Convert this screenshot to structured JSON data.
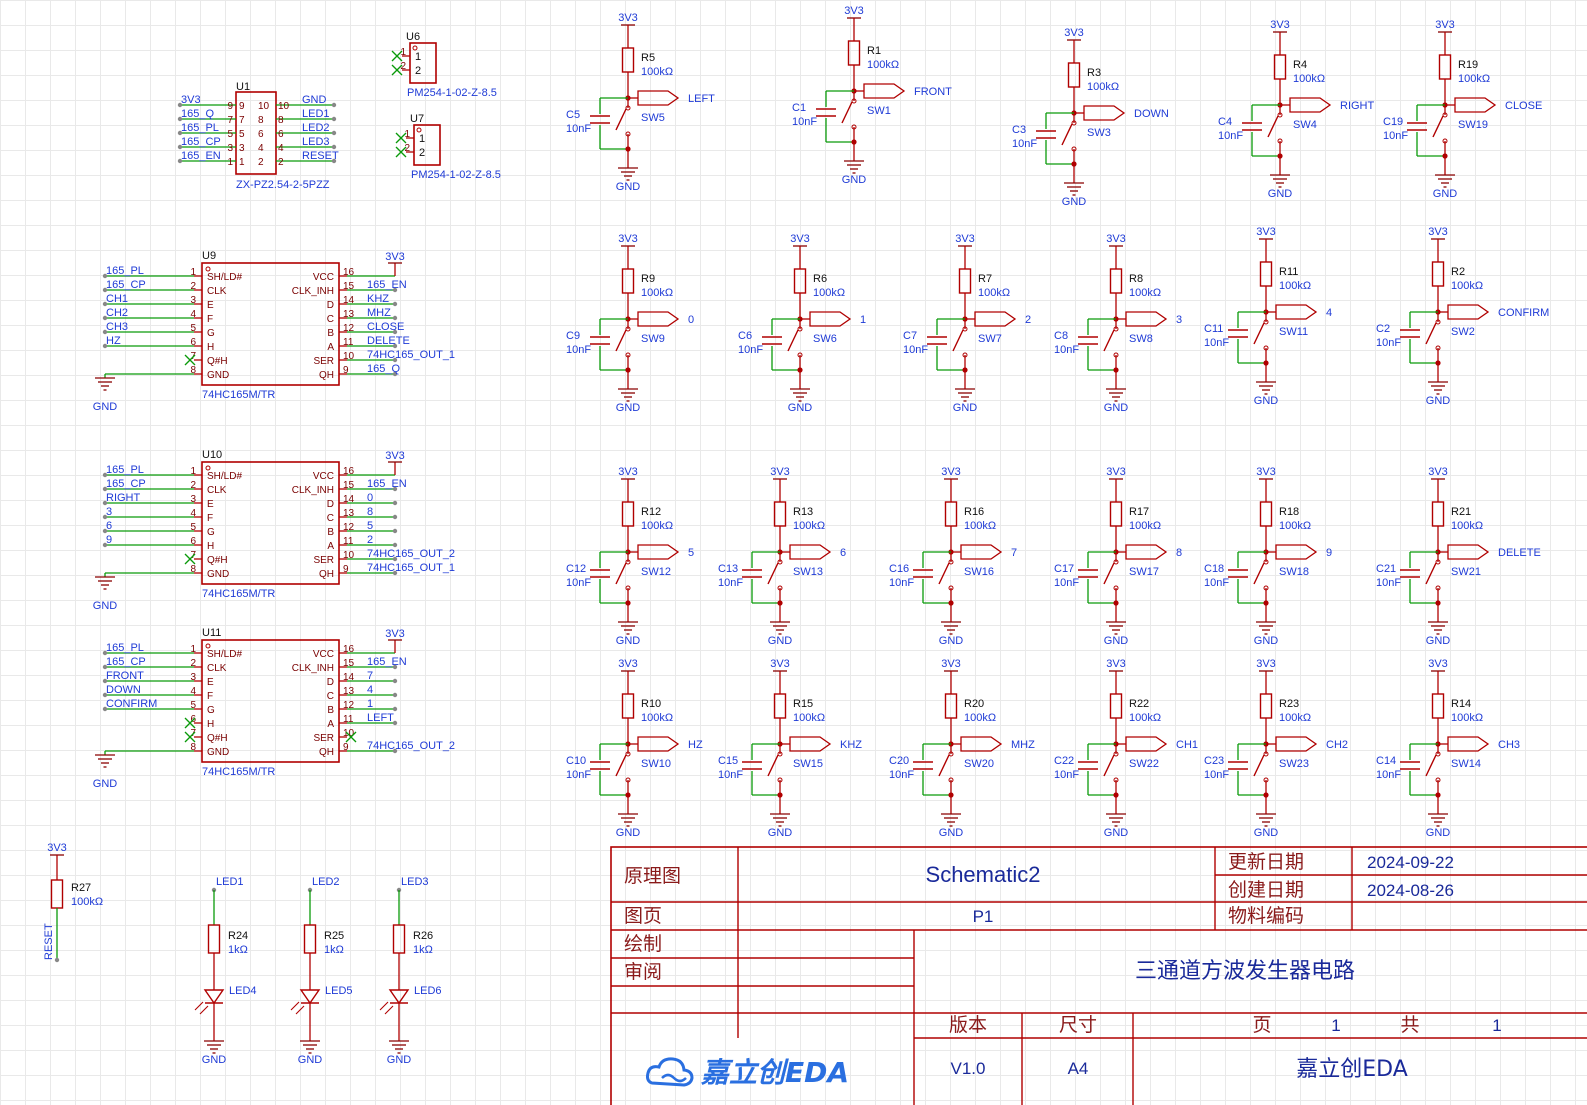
{
  "connector_u1": {
    "ref": "U1",
    "part": "ZX-PZ2.54-2-5PZZ",
    "left_nets": [
      "3V3",
      "165_Q",
      "165_PL",
      "165_CP",
      "165_EN"
    ],
    "right_nets": [
      "GND",
      "LED1",
      "LED2",
      "LED3",
      "RESET"
    ],
    "pins_left_outer": [
      "9",
      "7",
      "5",
      "3",
      "1"
    ],
    "pins_left_inner": [
      "9",
      "7",
      "5",
      "3",
      "1"
    ],
    "pins_right_inner": [
      "10",
      "8",
      "6",
      "4",
      "2"
    ],
    "pins_right_outer": [
      "10",
      "8",
      "6",
      "4",
      "2"
    ]
  },
  "jumpers": [
    {
      "ref": "U6",
      "part": "PM254-1-02-Z-8.5",
      "pins": [
        "1",
        "2"
      ]
    },
    {
      "ref": "U7",
      "part": "PM254-1-02-Z-8.5",
      "pins": [
        "1",
        "2"
      ]
    }
  ],
  "shift_registers": [
    {
      "ref": "U9",
      "part": "74HC165M/TR",
      "left_nets": [
        "165_PL",
        "165_CP",
        "CH1",
        "CH2",
        "CH3",
        "HZ",
        "",
        ""
      ],
      "right_nets": [
        "",
        "165_EN",
        "KHZ",
        "MHZ",
        "CLOSE",
        "DELETE",
        "74HC165_OUT_1",
        "165_Q"
      ]
    },
    {
      "ref": "U10",
      "part": "74HC165M/TR",
      "left_nets": [
        "165_PL",
        "165_CP",
        "RIGHT",
        "3",
        "6",
        "9",
        "",
        ""
      ],
      "right_nets": [
        "",
        "165_EN",
        "0",
        "8",
        "5",
        "2",
        "74HC165_OUT_2",
        "74HC165_OUT_1"
      ]
    },
    {
      "ref": "U11",
      "part": "74HC165M/TR",
      "left_nets": [
        "165_PL",
        "165_CP",
        "FRONT",
        "DOWN",
        "CONFIRM",
        "",
        "",
        ""
      ],
      "right_nets": [
        "",
        "165_EN",
        "7",
        "4",
        "1",
        "LEFT",
        "",
        "74HC165_OUT_2"
      ]
    }
  ],
  "ic_pin_names_left": [
    "SH/LD#",
    "CLK",
    "E",
    "F",
    "G",
    "H",
    "Q#H",
    "GND"
  ],
  "ic_pin_names_right": [
    "VCC",
    "CLK_INH",
    "D",
    "C",
    "B",
    "A",
    "SER",
    "QH"
  ],
  "ic_pins_left": [
    "1",
    "2",
    "3",
    "4",
    "5",
    "6",
    "7",
    "8"
  ],
  "ic_pins_right": [
    "16",
    "15",
    "14",
    "13",
    "12",
    "11",
    "10",
    "9"
  ],
  "power_net": "3V3",
  "ground_net": "GND",
  "resistor_value": "100kΩ",
  "cap_value": "10nF",
  "button_circuits": [
    {
      "r": "R5",
      "c": "C5",
      "sw": "SW5",
      "net": "LEFT"
    },
    {
      "r": "R1",
      "c": "C1",
      "sw": "SW1",
      "net": "FRONT"
    },
    {
      "r": "R3",
      "c": "C3",
      "sw": "SW3",
      "net": "DOWN"
    },
    {
      "r": "R4",
      "c": "C4",
      "sw": "SW4",
      "net": "RIGHT"
    },
    {
      "r": "R19",
      "c": "C19",
      "sw": "SW19",
      "net": "CLOSE"
    },
    {
      "r": "R9",
      "c": "C9",
      "sw": "SW9",
      "net": "0"
    },
    {
      "r": "R6",
      "c": "C6",
      "sw": "SW6",
      "net": "1"
    },
    {
      "r": "R7",
      "c": "C7",
      "sw": "SW7",
      "net": "2"
    },
    {
      "r": "R8",
      "c": "C8",
      "sw": "SW8",
      "net": "3"
    },
    {
      "r": "R11",
      "c": "C11",
      "sw": "SW11",
      "net": "4"
    },
    {
      "r": "R2",
      "c": "C2",
      "sw": "SW2",
      "net": "CONFIRM"
    },
    {
      "r": "R12",
      "c": "C12",
      "sw": "SW12",
      "net": "5"
    },
    {
      "r": "R13",
      "c": "C13",
      "sw": "SW13",
      "net": "6"
    },
    {
      "r": "R16",
      "c": "C16",
      "sw": "SW16",
      "net": "7"
    },
    {
      "r": "R17",
      "c": "C17",
      "sw": "SW17",
      "net": "8"
    },
    {
      "r": "R18",
      "c": "C18",
      "sw": "SW18",
      "net": "9"
    },
    {
      "r": "R21",
      "c": "C21",
      "sw": "SW21",
      "net": "DELETE"
    },
    {
      "r": "R10",
      "c": "C10",
      "sw": "SW10",
      "net": "HZ"
    },
    {
      "r": "R15",
      "c": "C15",
      "sw": "SW15",
      "net": "KHZ"
    },
    {
      "r": "R20",
      "c": "C20",
      "sw": "SW20",
      "net": "MHZ"
    },
    {
      "r": "R22",
      "c": "C22",
      "sw": "SW22",
      "net": "CH1"
    },
    {
      "r": "R23",
      "c": "C23",
      "sw": "SW23",
      "net": "CH2"
    },
    {
      "r": "R14",
      "c": "C14",
      "sw": "SW14",
      "net": "CH3"
    }
  ],
  "reset_pullup": {
    "ref": "R27",
    "value": "100kΩ",
    "net": "RESET",
    "supply": "3V3"
  },
  "leds": [
    {
      "net": "LED1",
      "r": "R24",
      "value": "1kΩ",
      "led": "LED4"
    },
    {
      "net": "LED2",
      "r": "R25",
      "value": "1kΩ",
      "led": "LED5"
    },
    {
      "net": "LED3",
      "r": "R26",
      "value": "1kΩ",
      "led": "LED6"
    }
  ],
  "title_block": {
    "label_schematic": "原理图",
    "schematic_name": "Schematic2",
    "label_updated": "更新日期",
    "updated": "2024-09-22",
    "label_created": "创建日期",
    "created": "2024-08-26",
    "label_page": "图页",
    "page": "P1",
    "label_material": "物料编码",
    "label_drawn": "绘制",
    "label_review": "审阅",
    "title": "三通道方波发生器电路",
    "label_version": "版本",
    "label_size": "尺寸",
    "label_pg": "页",
    "pg_value": "1",
    "label_total": "共",
    "total_value": "1",
    "logo_text": "嘉立创EDA",
    "version": "V1.0",
    "size": "A4",
    "company": "嘉立创EDA"
  }
}
